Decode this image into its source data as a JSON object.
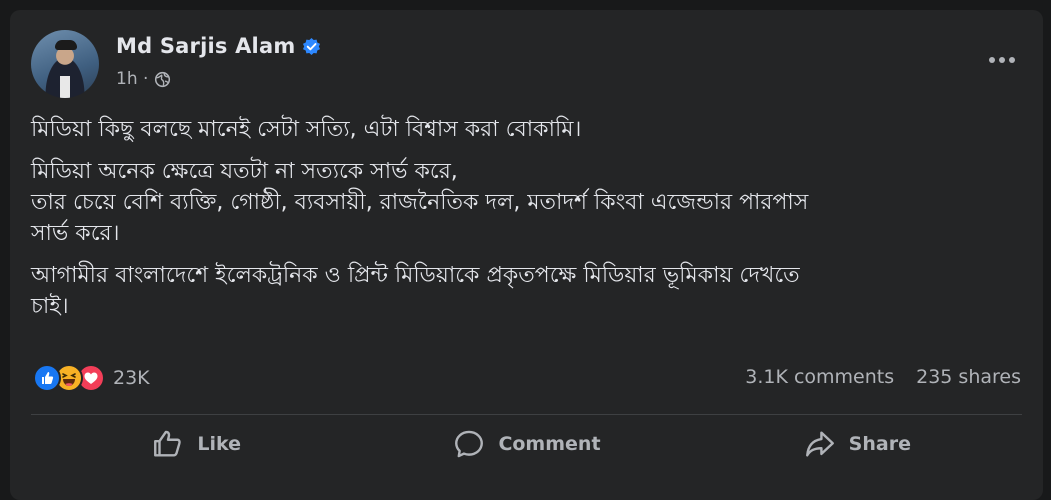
{
  "post": {
    "author": "Md Sarjis Alam",
    "time": "1h ·",
    "paragraphs": [
      "মিডিয়া কিছু বলছে মানেই সেটা সত্যি, এটা বিশ্বাস করা বোকামি।",
      "মিডিয়া অনেক ক্ষেত্রে যতটা না সত্যকে সার্ভ করে,\nতার চেয়ে বেশি ব্যক্তি, গোষ্ঠী, ব্যবসায়ী, রাজনৈতিক দল, মতাদর্শ কিংবা এজেন্ডার পারপাস\nসার্ভ করে।",
      "আগামীর বাংলাদেশে ইলেকট্রনিক ও প্রিন্ট মিডিয়াকে প্রকৃতপক্ষে মিডিয়ার ভূমিকায় দেখতে\nচাই।"
    ]
  },
  "reactions": {
    "icons": [
      "like-reaction-icon",
      "haha-reaction-icon",
      "love-reaction-icon"
    ],
    "count": "23K"
  },
  "stats": {
    "comments": "3.1K comments",
    "shares": "235 shares"
  },
  "actions": {
    "like": "Like",
    "comment": "Comment",
    "share": "Share"
  },
  "colors": {
    "background": "#18191a",
    "card": "#242526",
    "text_primary": "#e4e6eb",
    "text_secondary": "#b0b3b8",
    "verified": "#2d88ff",
    "like": "#1877f2",
    "love": "#f33e58",
    "haha": "#f7b125"
  }
}
